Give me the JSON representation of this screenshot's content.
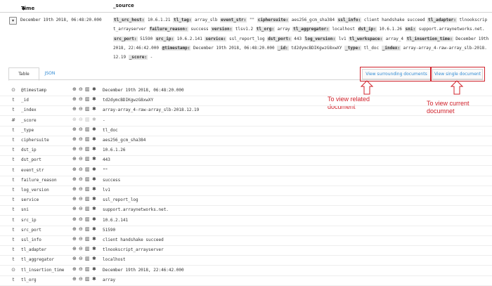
{
  "header": {
    "time_label": "Time",
    "source_label": "_source",
    "sort_icon": "sort-down-icon"
  },
  "doc": {
    "time": "December 19th 2018, 06:48:20.000",
    "source_pairs": [
      [
        "tl_src_host:",
        " 10.6.1.21 "
      ],
      [
        "tl_tag:",
        " array_slb "
      ],
      [
        "event_str:",
        " \"\" "
      ],
      [
        "ciphersuite:",
        " aes256_gcm_sha384 "
      ],
      [
        "ssl_info:",
        " client handshake succeed "
      ],
      [
        "tl_adapter:",
        " tlnookscript_arrayserver "
      ],
      [
        "failure_reason:",
        " success "
      ],
      [
        "version:",
        " tlsv1.2 "
      ],
      [
        "tl_org:",
        " array "
      ],
      [
        "tl_aggregator:",
        " localhost "
      ],
      [
        "dst_ip:",
        " 10.6.1.26 "
      ],
      [
        "sni:",
        " support.arraynetworks.net. "
      ],
      [
        "src_port:",
        " 51590 "
      ],
      [
        "src_ip:",
        " 10.6.2.141 "
      ],
      [
        "service:",
        " ssl_report_log "
      ],
      [
        "dst_port:",
        " 443 "
      ],
      [
        "log_version:",
        " lv1 "
      ],
      [
        "tl_workspace:",
        " array_4 "
      ],
      [
        "tl_insertion_time:",
        " December 19th 2018, 22:46:42.000 "
      ],
      [
        "@timestamp:",
        " December 19th 2018, 06:48:20.000 "
      ],
      [
        "_id:",
        " td2dymcBDIKgwzG8xwXY "
      ],
      [
        "_type:",
        " tl_doc "
      ],
      [
        "_index:",
        " array-array_4-raw-array_slb-2018.12.19 "
      ],
      [
        "_score:",
        " - "
      ]
    ]
  },
  "tabs": {
    "table": "Table",
    "json": "JSON"
  },
  "actions": {
    "surrounding": "View surrounding documents",
    "single": "View single document"
  },
  "annotations": {
    "related": "To view related document",
    "current": "To view current documnet"
  },
  "action_icons": [
    "zoom-in-icon",
    "zoom-out-icon",
    "toggle-column-icon",
    "filter-exists-icon"
  ],
  "fields": [
    {
      "type": "⊙",
      "name": "@timestamp",
      "value": "December 19th 2018, 06:48:20.000"
    },
    {
      "type": "t",
      "name": "_id",
      "value": "td2dymcBDIKgwzG8xwXY"
    },
    {
      "type": "t",
      "name": "_index",
      "value": "array-array_4-raw-array_slb-2018.12.19"
    },
    {
      "type": "#",
      "name": "_score",
      "value": "-"
    },
    {
      "type": "t",
      "name": "_type",
      "value": "tl_doc"
    },
    {
      "type": "t",
      "name": "ciphersuite",
      "value": "aes256_gcm_sha384"
    },
    {
      "type": "t",
      "name": "dst_ip",
      "value": "10.6.1.26"
    },
    {
      "type": "t",
      "name": "dst_port",
      "value": "443"
    },
    {
      "type": "t",
      "name": "event_str",
      "value": "\"\""
    },
    {
      "type": "t",
      "name": "failure_reason",
      "value": "success"
    },
    {
      "type": "t",
      "name": "log_version",
      "value": "lv1"
    },
    {
      "type": "t",
      "name": "service",
      "value": "ssl_report_log"
    },
    {
      "type": "t",
      "name": "sni",
      "value": "support.arraynetworks.net."
    },
    {
      "type": "t",
      "name": "src_ip",
      "value": "10.6.2.141"
    },
    {
      "type": "t",
      "name": "src_port",
      "value": "51590"
    },
    {
      "type": "t",
      "name": "ssl_info",
      "value": "client handshake succeed"
    },
    {
      "type": "t",
      "name": "tl_adapter",
      "value": "tlnookscript_arrayserver"
    },
    {
      "type": "t",
      "name": "tl_aggregator",
      "value": "localhost"
    },
    {
      "type": "⊙",
      "name": "tl_insertion_time",
      "value": "December 19th 2018, 22:46:42.000"
    },
    {
      "type": "t",
      "name": "tl_org",
      "value": "array"
    }
  ],
  "colors": {
    "accent": "#2f8ad4",
    "annotation": "#d0212a"
  }
}
